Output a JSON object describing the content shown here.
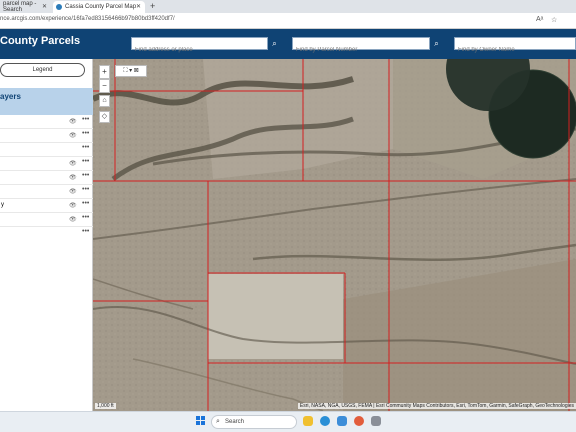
{
  "browser": {
    "tabs": [
      {
        "label": "parcel map - Search",
        "active": false
      },
      {
        "label": "Cassia County Parcel Map",
        "active": true
      }
    ],
    "url": "nce.arcgis.com/experience/16fa7ed83156466b97b80bd3ff420df7/"
  },
  "app": {
    "title": "County Parcels",
    "search_address_placeholder": "Find address or place",
    "search_parcel_placeholder": "Find by Parcel Number",
    "search_owner_placeholder": "Find by Owner Name"
  },
  "panel": {
    "legend_label": "Legend",
    "layers_title": "ayers",
    "layer_rows": [
      {
        "label": "",
        "visible": true,
        "dots": "•••"
      },
      {
        "label": "",
        "visible": true,
        "dots": "•••"
      },
      {
        "label": "",
        "visible": false,
        "dots": "•••"
      },
      {
        "label": "",
        "visible": true,
        "dots": "•••"
      },
      {
        "label": "",
        "visible": true,
        "dots": "•••"
      },
      {
        "label": "",
        "visible": true,
        "dots": "•••"
      },
      {
        "label": "y",
        "visible": true,
        "dots": "•••"
      },
      {
        "label": "",
        "visible": true,
        "dots": "•••"
      },
      {
        "label": "",
        "visible": false,
        "dots": "•••"
      }
    ]
  },
  "map": {
    "zoom_in": "+",
    "zoom_out": "−",
    "scale_label": "1,000 ft",
    "attribution": "Esri, NASA, NGA, USGS, FEMA | Esri Community Maps Contributors, Esri, TomTom, Garmin, SafeGraph, GeoTechnologies",
    "parcel_line_color": "#d42020"
  },
  "taskbar": {
    "search_label": "Search"
  },
  "colors": {
    "header": "#0f4374",
    "layers_header": "#b8d2ea"
  }
}
